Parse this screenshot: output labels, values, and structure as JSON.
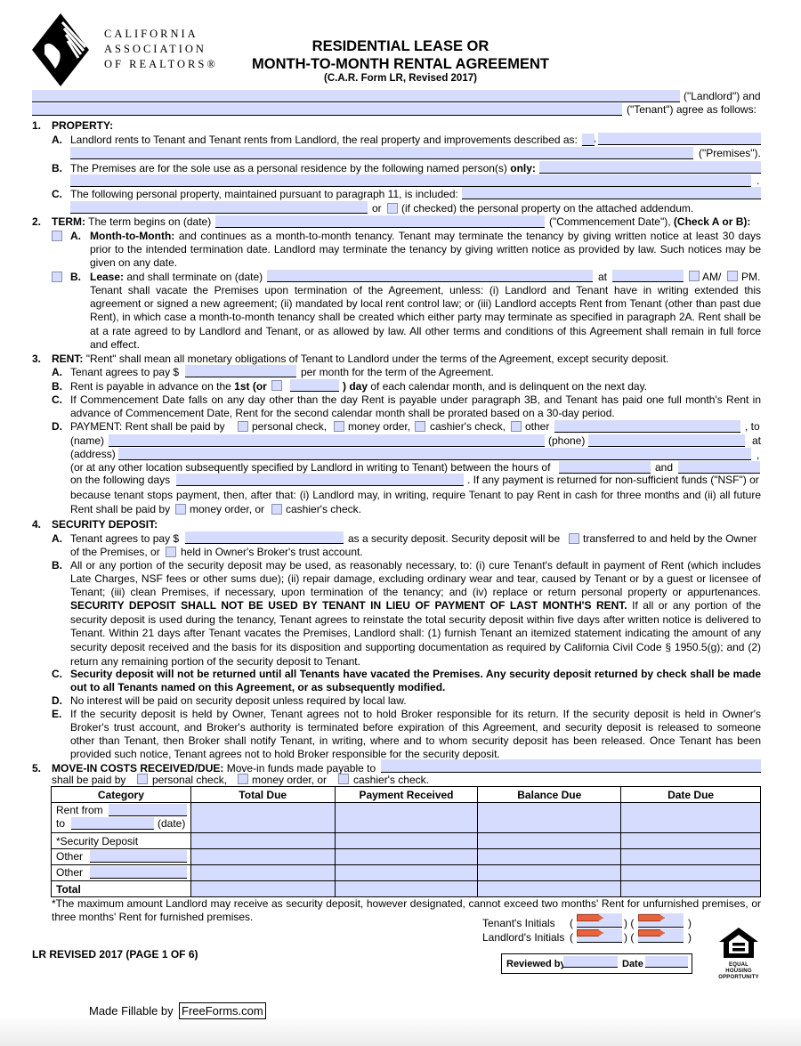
{
  "header": {
    "org_line1": "CALIFORNIA",
    "org_line2": "ASSOCIATION",
    "org_line3": "OF REALTORS®",
    "title_line1": "RESIDENTIAL LEASE OR",
    "title_line2": "MONTH-TO-MONTH RENTAL AGREEMENT",
    "subtitle": "(C.A.R. Form LR, Revised 2017)"
  },
  "parties": {
    "landlord_field": "",
    "landlord_suffix": "(\"Landlord\") and",
    "tenant_field": "",
    "tenant_suffix": "(\"Tenant\") agree as follows:"
  },
  "s1": {
    "num": "1.",
    "heading": "PROPERTY:",
    "a_label": "A.",
    "a_text": "Landlord rents to Tenant and Tenant rents from Landlord, the real property and improvements described as:",
    "a_comma": ",",
    "a_premises": "(\"Premises\").",
    "b_label": "B.",
    "b_text": "The Premises are for the sole use as a personal residence by the following named person(s)",
    "b_only": "only:",
    "b_period": ".",
    "c_label": "C.",
    "c_text": "The following personal property, maintained pursuant to paragraph 11, is included:",
    "c_or": "or",
    "c_checked": "(if checked) the personal property on the attached addendum."
  },
  "s2": {
    "num": "2.",
    "heading": "TERM:",
    "begins": "The term begins on (date)",
    "commencement": "(\"Commencement Date\"),",
    "check": "(Check A or B):",
    "a_label": "A.",
    "a_title": "Month-to-Month:",
    "a_line1": "and continues as a month-to-month tenancy. Tenant may terminate the tenancy by giving written notice at least 30 days",
    "a_line2": "prior to the intended termination date. Landlord may terminate the tenancy by giving written notice as provided by law. Such notices may be",
    "a_line3": "given on any date.",
    "b_label": "B.",
    "b_title": "Lease:",
    "b_text": "and shall terminate on (date)",
    "b_at": "at",
    "b_am": "AM/",
    "b_pm": "PM.",
    "b_line1": "Tenant shall vacate the Premises upon termination of the Agreement, unless: (i) Landlord and Tenant have in writing extended this",
    "b_line2": "agreement or signed a new agreement; (ii) mandated by local rent control law; or (iii) Landlord accepts Rent from Tenant (other than past due",
    "b_line3": "Rent), in which case a month-to-month tenancy shall be created which either party may terminate as specified in paragraph 2A. Rent shall be",
    "b_line4": "at a rate agreed to by Landlord and Tenant, or as allowed by law. All other terms and conditions of this Agreement shall remain in full force",
    "b_line5": "and effect."
  },
  "s3": {
    "num": "3.",
    "heading": "RENT:",
    "intro": "\"Rent\" shall mean all monetary obligations of Tenant to Landlord under the terms of the Agreement, except security deposit.",
    "a_label": "A.",
    "a_text": "Tenant agrees to pay $",
    "a_suffix": "per month for the term of the Agreement.",
    "b_label": "B.",
    "b_text": "Rent is payable in advance on the",
    "b_first": "1st (or",
    "b_day": ") day",
    "b_suffix": "of each calendar month, and is delinquent on the next day.",
    "c_label": "C.",
    "c_line1": "If Commencement Date falls on any day other than the day Rent is payable under paragraph 3B, and Tenant has paid one full month's Rent in",
    "c_line2": "advance of Commencement Date, Rent for the second calendar month shall be prorated based on a 30-day period.",
    "d_label": "D.",
    "d_text": "PAYMENT: Rent shall be paid by",
    "d_personal": "personal check,",
    "d_money": "money order,",
    "d_cashier": "cashier's check,",
    "d_other": "other",
    "d_to": ", to",
    "d_name": "(name)",
    "d_phone": "(phone)",
    "d_at": "at",
    "d_address": "(address)",
    "d_comma": ",",
    "d_location": "(or at any other location subsequently specified by Landlord in writing to Tenant) between the hours of",
    "d_and": "and",
    "d_period": ".",
    "d_days": "on the following days",
    "d_nsf": ". If any payment is returned for non-sufficient funds (\"NSF\") or",
    "d_stops": "because tenant stops payment, then, after that: (i) Landlord may, in writing, require Tenant to pay Rent in cash for three months and (ii) all future",
    "d_future": "Rent shall be paid by",
    "d_money2": "money order, or",
    "d_cashier2": "cashier's check."
  },
  "s4": {
    "num": "4.",
    "heading": "SECURITY DEPOSIT:",
    "a_label": "A.",
    "a_text": "Tenant agrees to pay $",
    "a_suffix": "as a security deposit. Security deposit will be",
    "a_transferred": "transferred to and held by the Owner",
    "a_line2a": "of the Premises, or",
    "a_line2b": "held in Owner's Broker's trust account.",
    "b_label": "B.",
    "b_line1": "All or any portion of the security deposit may be used, as reasonably necessary, to: (i) cure Tenant's default in payment of Rent (which includes",
    "b_line2": "Late Charges, NSF fees or other sums due); (ii) repair damage, excluding ordinary wear and tear, caused by Tenant or by a guest or licensee of",
    "b_line3": "Tenant; (iii) clean Premises, if necessary, upon termination of the tenancy; and (iv) replace or return personal property or appurtenances.",
    "b_line4_bold": "SECURITY DEPOSIT SHALL NOT BE USED BY TENANT IN LIEU OF PAYMENT OF LAST MONTH'S RENT.",
    "b_line4_rest": "If all or any portion of the",
    "b_line5": "security deposit is used during the tenancy, Tenant agrees to reinstate the total security deposit within five days after written notice is delivered to",
    "b_line6": "Tenant. Within 21 days after Tenant vacates the Premises, Landlord shall: (1) furnish Tenant an itemized statement indicating the amount of any",
    "b_line7": "security deposit received and the basis for its disposition and supporting documentation as required by California Civil Code § 1950.5(g); and (2)",
    "b_line8": "return any remaining portion of the security deposit to Tenant.",
    "c_label": "C.",
    "c_line1": "Security deposit will not be returned until all Tenants have vacated the Premises. Any security deposit returned by check shall be made",
    "c_line2": "out to all Tenants named on this Agreement, or as subsequently modified.",
    "d_label": "D.",
    "d_text": "No interest will be paid on security deposit unless required by local law.",
    "e_label": "E.",
    "e_line1": "If the security deposit is held by Owner, Tenant agrees not to hold Broker responsible for its return. If the security deposit is held in Owner's",
    "e_line2": "Broker's trust account, and Broker's authority is terminated before expiration of this Agreement, and security deposit is released to someone",
    "e_line3": "other than Tenant, then Broker shall notify Tenant, in writing, where and to whom security deposit has been released. Once Tenant has been",
    "e_line4": "provided such notice, Tenant agrees not to hold Broker responsible for the security deposit."
  },
  "s5": {
    "num": "5.",
    "heading": "MOVE-IN COSTS RECEIVED/DUE:",
    "text": "Move-in funds made payable to",
    "paid_by": "shall be paid by",
    "personal": "personal check,",
    "money": "money order, or",
    "cashier": "cashier's check.",
    "table": {
      "headers": [
        "Category",
        "Total Due",
        "Payment Received",
        "Balance Due",
        "Date Due"
      ],
      "rent_from": "Rent from",
      "to": "to",
      "date": "(date)",
      "security": "*Security Deposit",
      "other1": "Other",
      "other2": "Other",
      "total": "Total"
    },
    "note_line1": "*The maximum amount Landlord may receive as security deposit, however designated, cannot exceed two months' Rent for unfurnished premises, or",
    "note_line2": "three months' Rent for furnished premises."
  },
  "footer": {
    "tenant_initials": "Tenant's Initials",
    "landlord_initials": "Landlord's Initials",
    "open_paren": "(",
    "mid_paren": ") (",
    "close_paren": ")",
    "revision": "LR REVISED 2017 (PAGE 1 OF 6)",
    "reviewed_by": "Reviewed by",
    "date": "Date",
    "eho_line1": "EQUAL HOUSING",
    "eho_line2": "OPPORTUNITY",
    "made_fillable": "Made Fillable by",
    "freeforms": "FreeForms.com"
  }
}
